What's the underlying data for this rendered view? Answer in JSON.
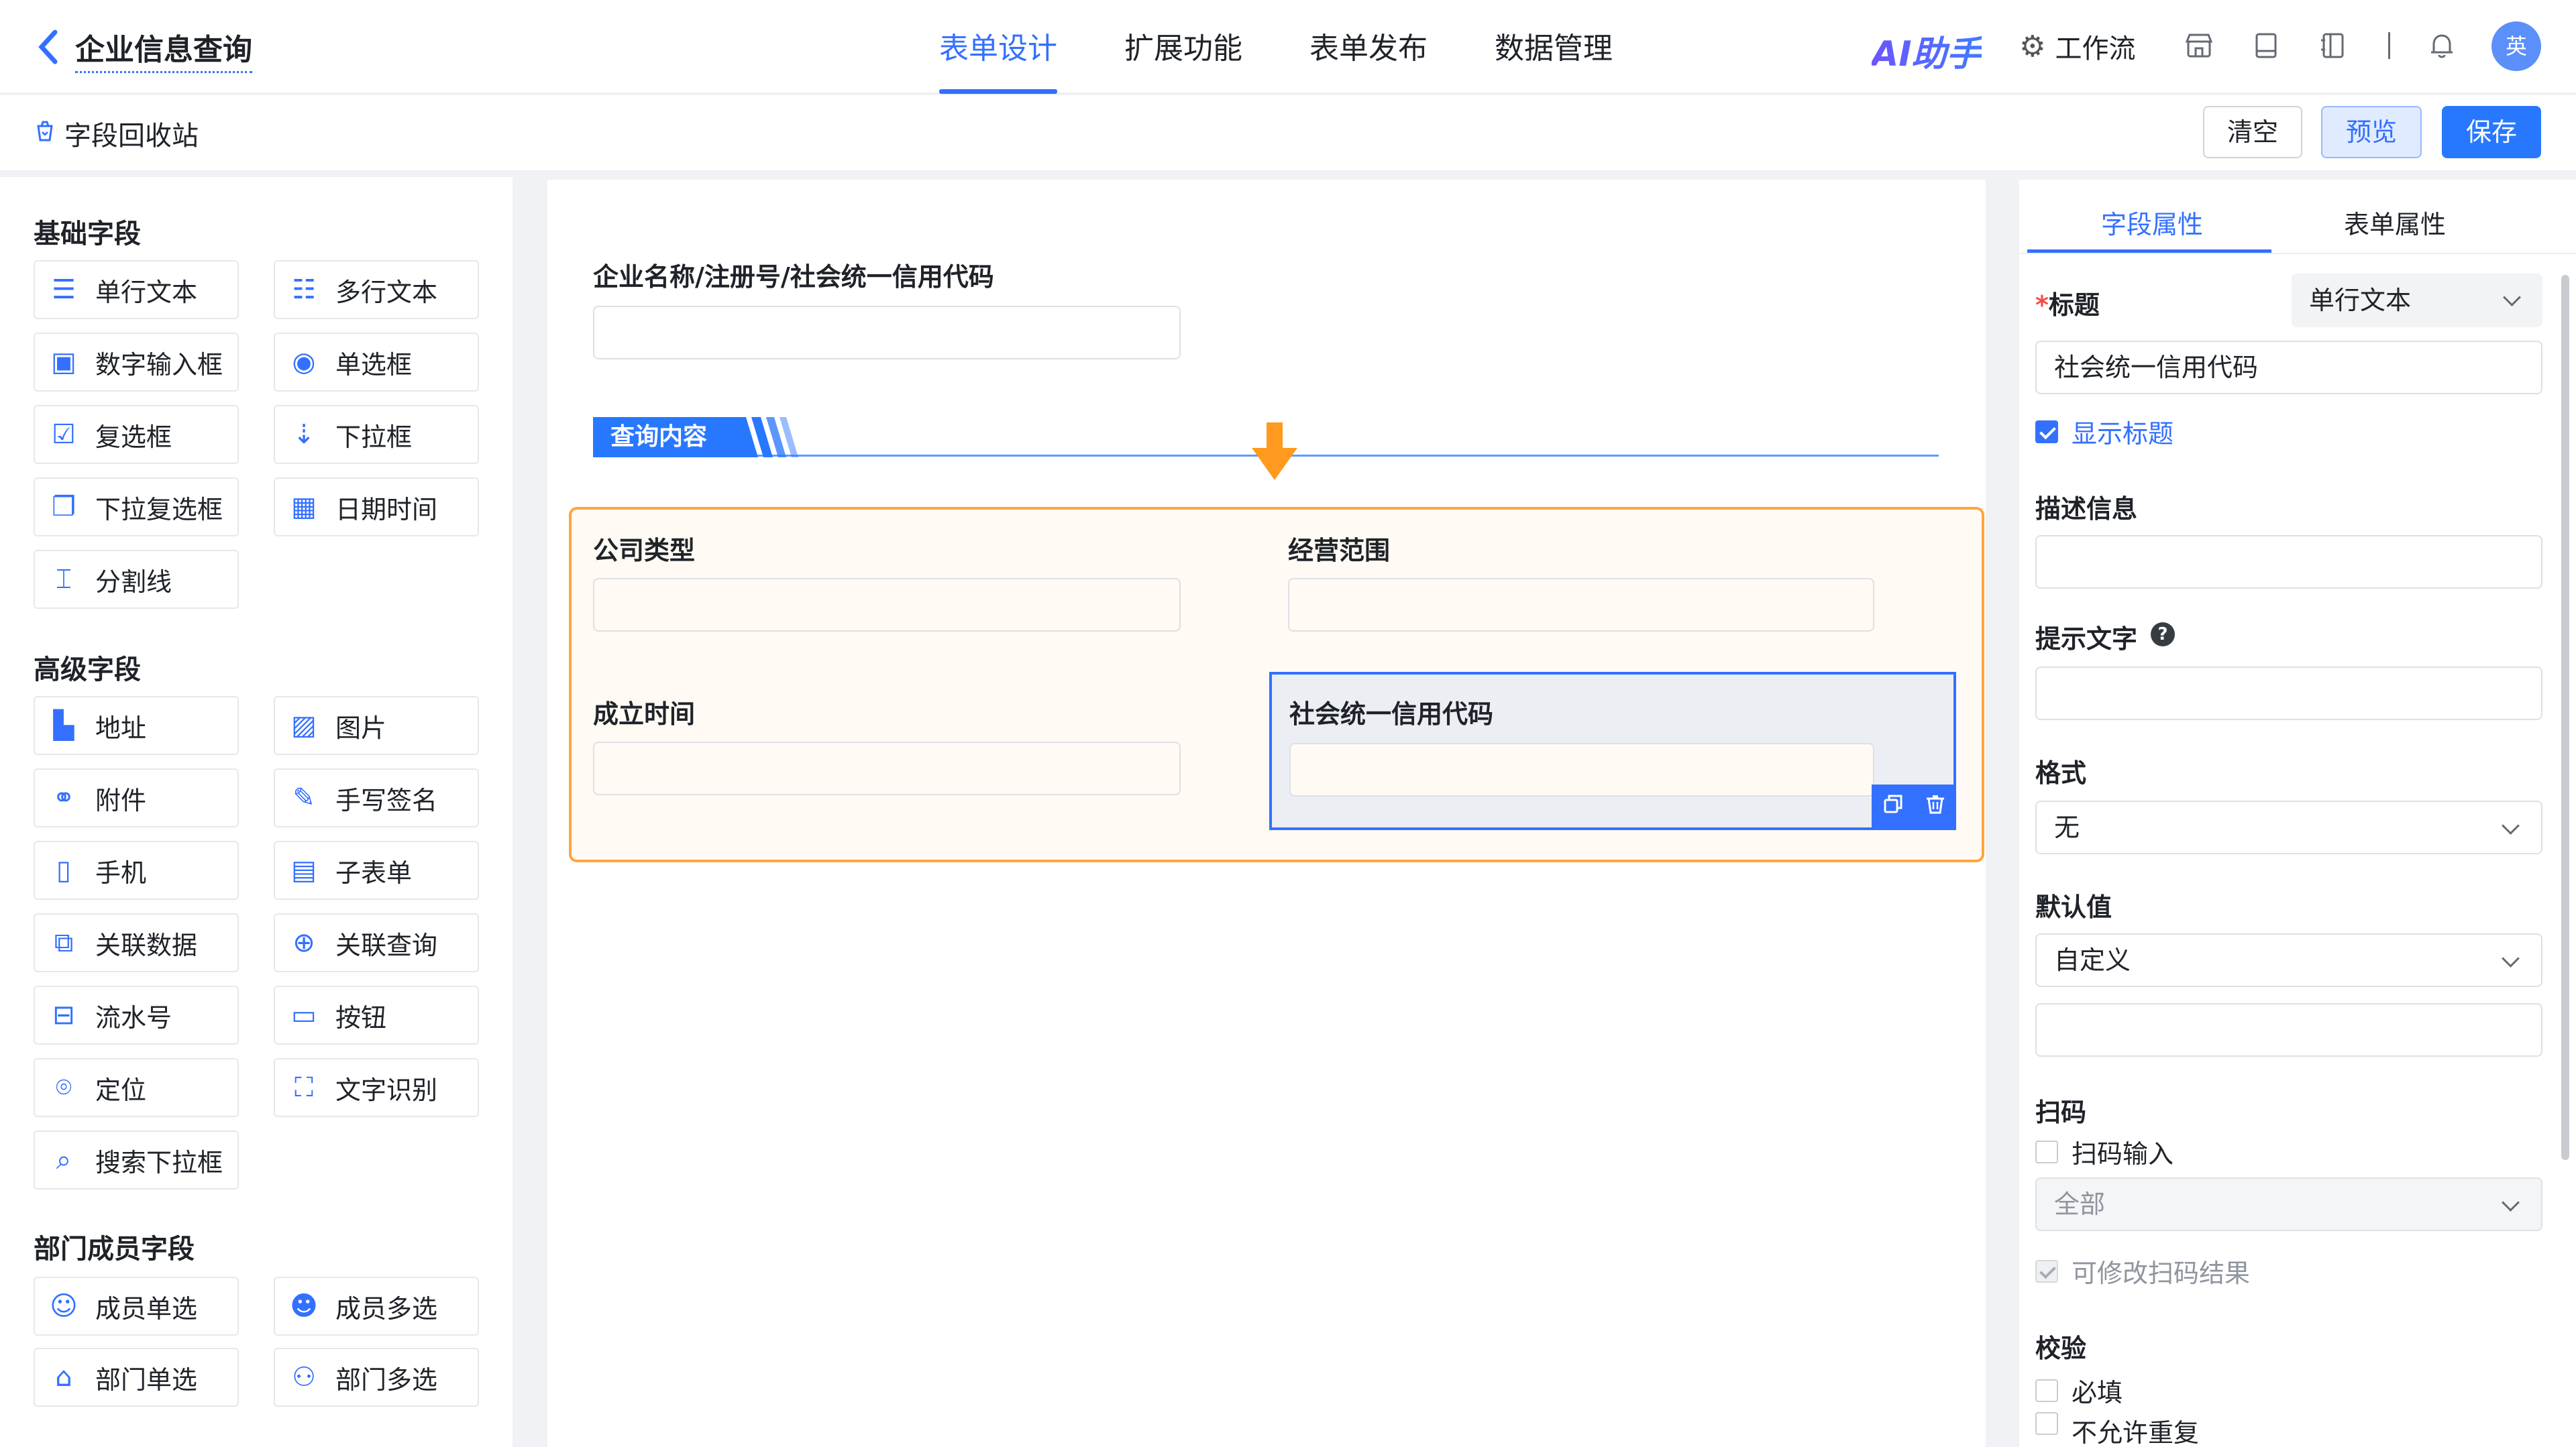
{
  "header": {
    "back_icon": "chevron-left-icon",
    "app_title": "企业信息查询",
    "tabs": [
      "表单设计",
      "扩展功能",
      "表单发布",
      "数据管理"
    ],
    "active_tab": "表单设计",
    "ai_label": "AI助手",
    "workflow_label": "工作流",
    "icons": [
      "store-icon",
      "book-icon",
      "notebook-icon",
      "bell-icon"
    ],
    "avatar_text": "英",
    "accent_color": "#3370ff"
  },
  "toolbar": {
    "recycle_label": "字段回收站",
    "clear_label": "清空",
    "preview_label": "预览",
    "save_label": "保存"
  },
  "left_panel": {
    "groups": [
      {
        "title": "基础字段",
        "items": [
          {
            "label": "单行文本",
            "icon": "single-line-text-icon"
          },
          {
            "label": "多行文本",
            "icon": "multi-line-text-icon"
          },
          {
            "label": "数字输入框",
            "icon": "number-input-icon"
          },
          {
            "label": "单选框",
            "icon": "radio-icon"
          },
          {
            "label": "复选框",
            "icon": "checkbox-icon"
          },
          {
            "label": "下拉框",
            "icon": "dropdown-icon"
          },
          {
            "label": "下拉复选框",
            "icon": "dropdown-checkbox-icon"
          },
          {
            "label": "日期时间",
            "icon": "calendar-icon"
          },
          {
            "label": "分割线",
            "icon": "divider-icon"
          }
        ]
      },
      {
        "title": "高级字段",
        "items": [
          {
            "label": "地址",
            "icon": "address-icon"
          },
          {
            "label": "图片",
            "icon": "image-icon"
          },
          {
            "label": "附件",
            "icon": "attachment-icon"
          },
          {
            "label": "手写签名",
            "icon": "signature-icon"
          },
          {
            "label": "手机",
            "icon": "phone-icon"
          },
          {
            "label": "子表单",
            "icon": "subform-icon"
          },
          {
            "label": "关联数据",
            "icon": "linked-data-icon"
          },
          {
            "label": "关联查询",
            "icon": "linked-query-icon"
          },
          {
            "label": "流水号",
            "icon": "serial-number-icon"
          },
          {
            "label": "按钮",
            "icon": "button-icon"
          },
          {
            "label": "定位",
            "icon": "location-icon"
          },
          {
            "label": "文字识别",
            "icon": "ocr-icon"
          },
          {
            "label": "搜索下拉框",
            "icon": "search-dropdown-icon"
          }
        ]
      },
      {
        "title": "部门成员字段",
        "items": [
          {
            "label": "成员单选",
            "icon": "member-single-icon"
          },
          {
            "label": "成员多选",
            "icon": "member-multi-icon"
          },
          {
            "label": "部门单选",
            "icon": "department-single-icon"
          },
          {
            "label": "部门多选",
            "icon": "department-multi-icon"
          }
        ]
      }
    ]
  },
  "canvas": {
    "query_field_label": "企业名称/注册号/社会统一信用代码",
    "section_title": "查询内容",
    "fields": {
      "company_type": "公司类型",
      "business_scope": "经营范围",
      "established": "成立时间",
      "credit_code": "社会统一信用代码"
    },
    "container_border_color": "#ffa53d",
    "selected_actions": [
      "copy-icon",
      "delete-icon"
    ]
  },
  "right_panel": {
    "tabs": [
      "字段属性",
      "表单属性"
    ],
    "active_tab": "字段属性",
    "title_label": "标题",
    "field_type": "单行文本",
    "title_value": "社会统一信用代码",
    "show_title_label": "显示标题",
    "show_title_checked": true,
    "description_label": "描述信息",
    "placeholder_label": "提示文字",
    "format_label": "格式",
    "format_value": "无",
    "default_label": "默认值",
    "default_mode": "自定义",
    "scan_label": "扫码",
    "scan_input_label": "扫码输入",
    "scan_input_checked": false,
    "scan_scope": "全部",
    "scan_editable_label": "可修改扫码结果",
    "validation_label": "校验",
    "required_label": "必填",
    "no_duplicate_label": "不允许重复"
  }
}
